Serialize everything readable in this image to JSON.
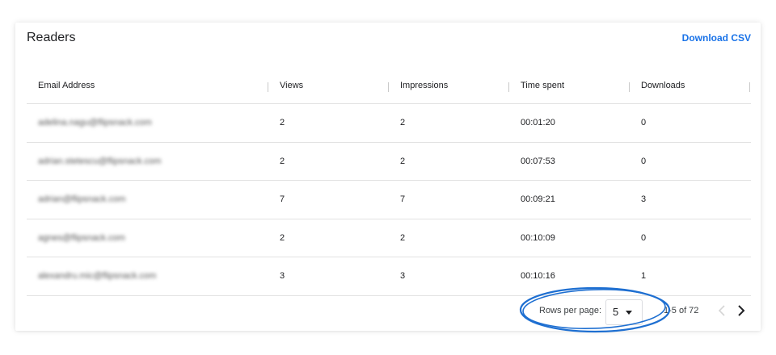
{
  "panel": {
    "title": "Readers",
    "download_label": "Download CSV"
  },
  "table": {
    "columns": [
      "Email Address",
      "Views",
      "Impressions",
      "Time spent",
      "Downloads"
    ],
    "rows": [
      [
        "adelina.nagu@flipsnack.com",
        "2",
        "2",
        "00:01:20",
        "0"
      ],
      [
        "adrian.stetescu@flipsnack.com",
        "2",
        "2",
        "00:07:53",
        "0"
      ],
      [
        "adrian@flipsnack.com",
        "7",
        "7",
        "00:09:21",
        "3"
      ],
      [
        "agnes@flipsnack.com",
        "2",
        "2",
        "00:10:09",
        "0"
      ],
      [
        "alexandru.mic@flipsnack.com",
        "3",
        "3",
        "00:10:16",
        "1"
      ]
    ]
  },
  "pagination": {
    "rows_per_page_label": "Rows per page:",
    "rows_per_page_value": "5",
    "range_text": "1-5 of 72",
    "prev_icon": "chevron-left-icon",
    "next_icon": "chevron-right-icon"
  },
  "colors": {
    "accent": "#1a73e8",
    "annotation": "#1e6fd1"
  }
}
